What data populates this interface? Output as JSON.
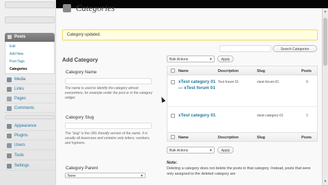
{
  "sidebar": {
    "posts_menu": {
      "label": "Posts"
    },
    "submenu": [
      {
        "label": "Edit"
      },
      {
        "label": "Add New"
      },
      {
        "label": "Post Tags"
      },
      {
        "label": "Categories",
        "current": true
      }
    ],
    "nav": [
      {
        "key": "media",
        "label": "Media",
        "icon": "media-icon"
      },
      {
        "key": "links",
        "label": "Links",
        "icon": "links-icon"
      },
      {
        "key": "pages",
        "label": "Pages",
        "icon": "pages-icon"
      },
      {
        "key": "comments",
        "label": "Comments",
        "icon": "comments-icon"
      },
      {
        "key": "appearance",
        "label": "Appearance",
        "icon": "appearance-icon"
      },
      {
        "key": "plugins",
        "label": "Plugins",
        "icon": "plugins-icon"
      },
      {
        "key": "users",
        "label": "Users",
        "icon": "users-icon"
      },
      {
        "key": "tools",
        "label": "Tools",
        "icon": "tools-icon"
      },
      {
        "key": "settings",
        "label": "Settings",
        "icon": "settings-icon"
      }
    ]
  },
  "page": {
    "title": "Categories",
    "notice": "Category updated."
  },
  "add_category": {
    "heading": "Add Category",
    "name_label": "Category Name",
    "name_help": "The name is used to identify the category almost everywhere, for example under the post or in the category widget.",
    "slug_label": "Category Slug",
    "slug_help": "The “slug” is the URL-friendly version of the name. It is usually all lowercase and contains only letters, numbers, and hyphens.",
    "parent_label": "Category Parent",
    "parent_value": "None"
  },
  "toolbar": {
    "bulk_actions": "Bulk Actions",
    "apply": "Apply",
    "search_button": "Search Categories"
  },
  "table": {
    "columns": {
      "name": "Name",
      "description": "Description",
      "slug": "Slug",
      "posts": "Posts"
    },
    "rows": [
      {
        "name": "xTest category 01 — xTest forum 01",
        "description": "Test forum 01",
        "slug": "xtest-forum-01",
        "posts": "0"
      },
      {
        "name": "xTest category 01",
        "description": "",
        "slug": "xtest-category-01",
        "posts": "1"
      }
    ]
  },
  "note": {
    "label": "Note:",
    "text": "Deleting a category does not delete the posts in that category. Instead, posts that were only assigned to the deleted category are"
  },
  "colors": {
    "accent_link": "#21759b",
    "notice_bg": "#ffffe0",
    "notice_border": "#e6db55",
    "menu_active": "#6d6d6d"
  }
}
